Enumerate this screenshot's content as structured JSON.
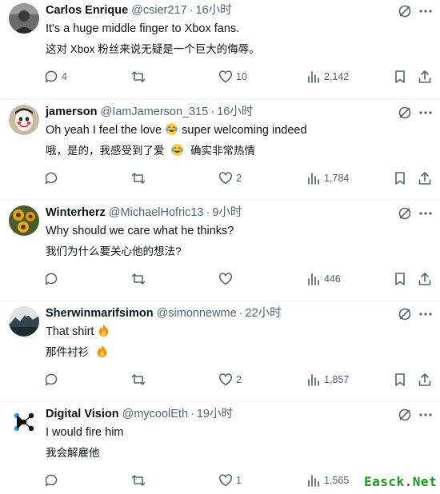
{
  "tweets": [
    {
      "name": "Carlos Enrique",
      "handle": "@csier217",
      "time": "16小时",
      "text": "It's a huge middle finger to Xbox fans.",
      "translation": "这对 Xbox 粉丝来说无疑是一个巨大的侮辱。",
      "replies": "4",
      "retweets": "",
      "likes": "10",
      "views": "2,142"
    },
    {
      "name": "jamerson",
      "handle": "@IamJamerson_315",
      "time": "16小时",
      "text_before": "Oh yeah I feel the love",
      "text_after": "super welcoming indeed",
      "translation_before": "哦，是的，我感受到了爱",
      "translation_after": "确实非常热情",
      "emoji": "face-with-tears-of-joy",
      "replies": "",
      "retweets": "",
      "likes": "2",
      "views": "1,784"
    },
    {
      "name": "Winterherz",
      "handle": "@MichaelHofric13",
      "time": "9小时",
      "text": "Why should we care what he thinks?",
      "translation": "我们为什么要关心他的想法?",
      "replies": "",
      "retweets": "",
      "likes": "",
      "views": "446"
    },
    {
      "name": "Sherwinmarifsimon",
      "handle": "@simonnewme",
      "time": "22小时",
      "text": "That shirt",
      "translation": "那件衬衫",
      "emoji": "fire",
      "replies": "",
      "retweets": "",
      "likes": "2",
      "views": "1,857"
    },
    {
      "name": "Digital Vision",
      "handle": "@mycoolEth",
      "time": "19小时",
      "text": "I would fire him",
      "translation": "我会解雇他",
      "replies": "",
      "retweets": "",
      "likes": "1",
      "views": "1,565"
    }
  ],
  "separator": "·",
  "watermark": "Easck.Net",
  "colors": {
    "text": "#0f1419",
    "muted": "#536471",
    "divider": "#eff3f4",
    "watermark": "#1a9a1a"
  }
}
